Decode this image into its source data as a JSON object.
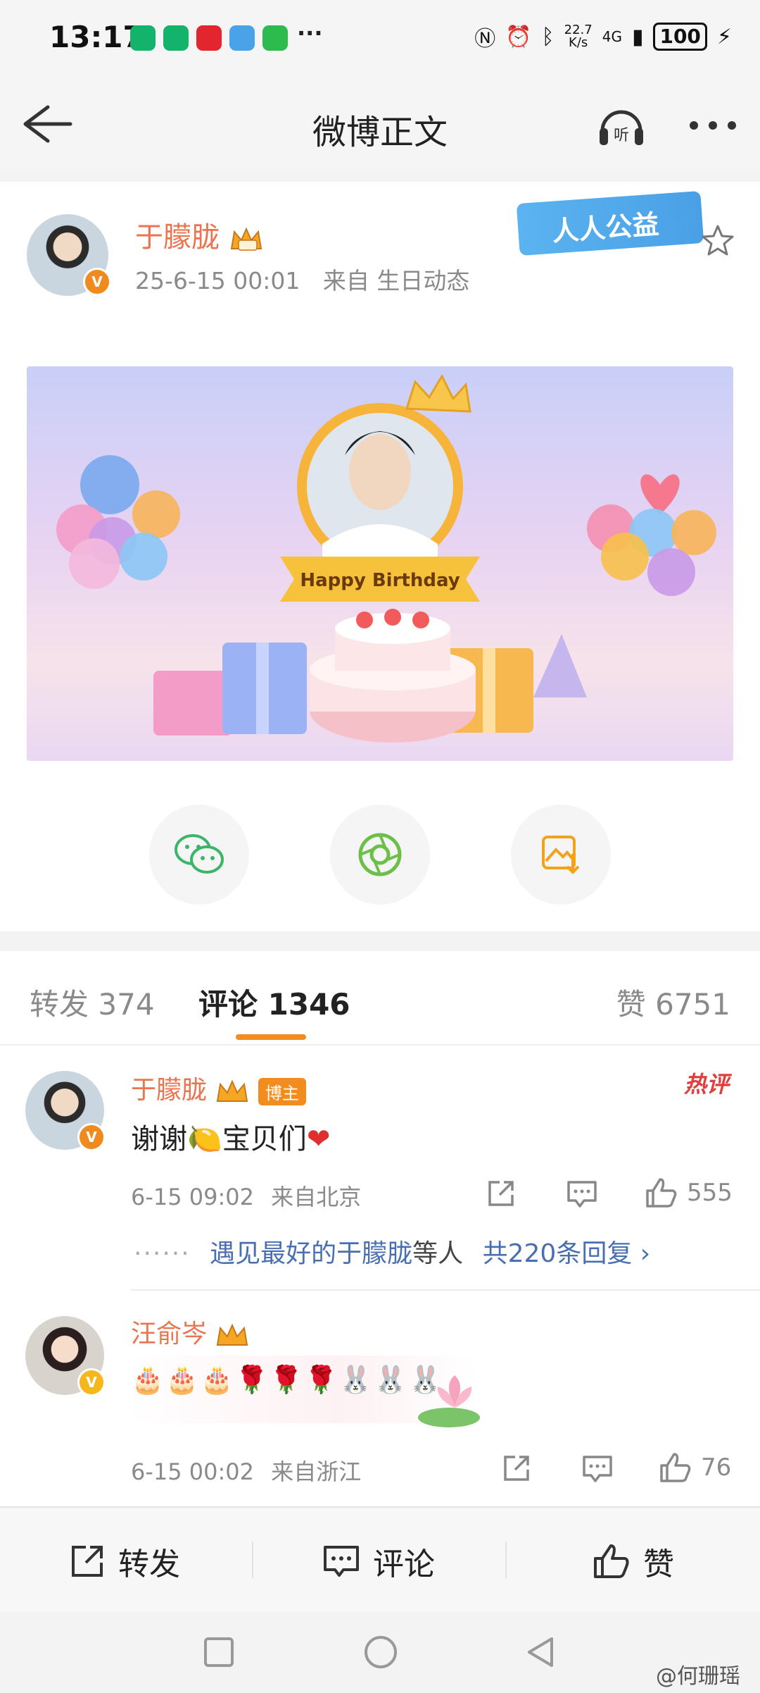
{
  "status": {
    "time": "13:17",
    "more": "···",
    "speed": "22.7\nK/s",
    "network": "4G",
    "battery": "100"
  },
  "nav": {
    "title": "微博正文"
  },
  "post": {
    "author": "于朦胧",
    "timestamp": "25-6-15 00:01",
    "source_prefix": "来自",
    "source": "生日动态",
    "charity_badge": "人人公益",
    "banner_text": "Happy Birthday"
  },
  "tabs": {
    "repost_label": "转发",
    "repost_count": "374",
    "comment_label": "评论",
    "comment_count": "1346",
    "like_label": "赞",
    "like_count": "6751"
  },
  "comments": [
    {
      "name": "于朦胧",
      "tag": "博主",
      "hot": "热评",
      "text_a": "谢谢",
      "text_b": "宝贝们",
      "time": "6-15 09:02",
      "location": "来自北京",
      "likes": "555",
      "reply_user": "遇见最好的于朦胧",
      "reply_suffix": "等人",
      "reply_total": "共220条回复 ›"
    },
    {
      "name": "汪俞岑",
      "text": "🎂🎂🎂🌹🌹🌹🐰🐰🐰",
      "time": "6-15 00:02",
      "location": "来自浙江",
      "likes": "76"
    }
  ],
  "actionbar": {
    "repost": "转发",
    "comment": "评论",
    "like": "赞"
  },
  "watermark": "@何珊瑶",
  "colors": {
    "accent": "#f38c1e",
    "username": "#eb7350",
    "link": "#4a6fb0"
  }
}
